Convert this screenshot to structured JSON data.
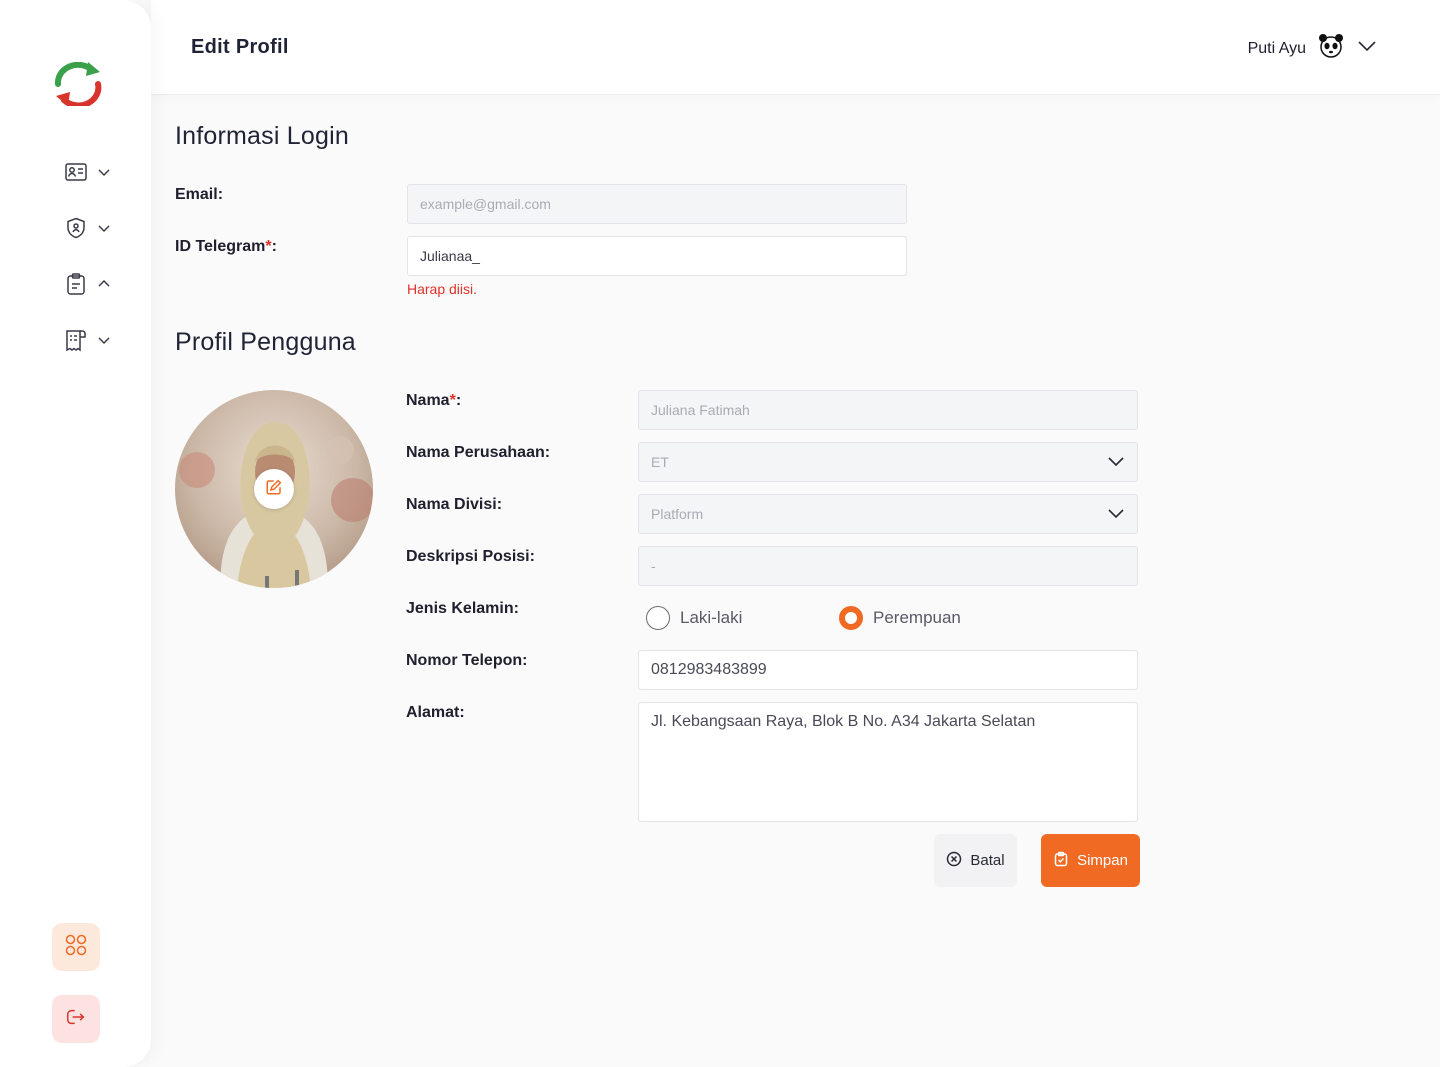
{
  "header": {
    "title": "Edit Profil",
    "user_name": "Puti Ayu"
  },
  "sidebar": {
    "items": [
      {
        "icon": "id-card-icon",
        "state": "collapsed"
      },
      {
        "icon": "shield-user-icon",
        "state": "collapsed"
      },
      {
        "icon": "clipboard-icon",
        "state": "expanded"
      },
      {
        "icon": "receipt-icon",
        "state": "collapsed"
      }
    ],
    "bottom": [
      {
        "icon": "apps-grid-icon"
      },
      {
        "icon": "logout-icon"
      }
    ]
  },
  "login_section": {
    "title": "Informasi Login",
    "email_label": "Email:",
    "email_placeholder": "example@gmail.com",
    "telegram_label": "ID Telegram",
    "telegram_required": "*",
    "telegram_suffix": ":",
    "telegram_value": "Julianaa_",
    "telegram_error": "Harap diisi."
  },
  "profile_section": {
    "title": "Profil Pengguna",
    "name_label": "Nama",
    "name_required": "*",
    "name_suffix": ":",
    "name_value": "Juliana Fatimah",
    "company_label": "Nama Perusahaan:",
    "company_value": "ET",
    "division_label": "Nama Divisi:",
    "division_value": "Platform",
    "position_label": "Deskripsi Posisi:",
    "position_value": "-",
    "gender_label": "Jenis Kelamin:",
    "gender_options": [
      "Laki-laki",
      "Perempuan"
    ],
    "gender_selected": "Perempuan",
    "phone_label": "Nomor Telepon:",
    "phone_value": "0812983483899",
    "address_label": "Alamat:",
    "address_value": "Jl. Kebangsaan Raya, Blok B No. A34 Jakarta Selatan"
  },
  "actions": {
    "cancel_label": "Batal",
    "save_label": "Simpan"
  },
  "colors": {
    "accent": "#f06a24",
    "error": "#e0312a",
    "logo_green": "#3aa04a",
    "logo_red": "#d8342c"
  }
}
